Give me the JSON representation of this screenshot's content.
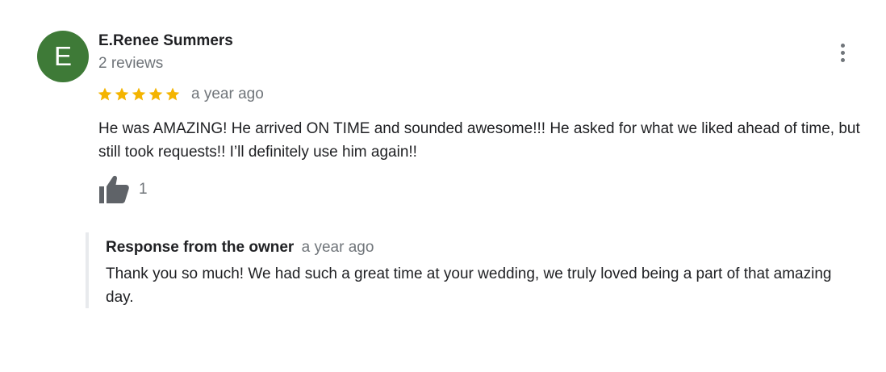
{
  "reviewer": {
    "initial": "E",
    "avatar_color": "#3e7a37",
    "name": "E.Renee Summers",
    "reviews_count": "2 reviews"
  },
  "review": {
    "rating": 5,
    "max_rating": 5,
    "star_color": "#f4b400",
    "time_ago": "a year ago",
    "text": "He was AMAZING! He arrived ON TIME and sounded awesome!!! He asked for what we liked ahead of time, but still took requests!! I’ll definitely use him again!!",
    "like_count": "1"
  },
  "icons": {
    "more_options": "more-vert-icon",
    "like": "thumbs-up-icon",
    "star": "star-icon"
  },
  "owner_response": {
    "title": "Response from the owner",
    "time_ago": "a year ago",
    "text": "Thank you so much! We had such a great time at your wedding, we truly loved being a part of that amazing day."
  }
}
